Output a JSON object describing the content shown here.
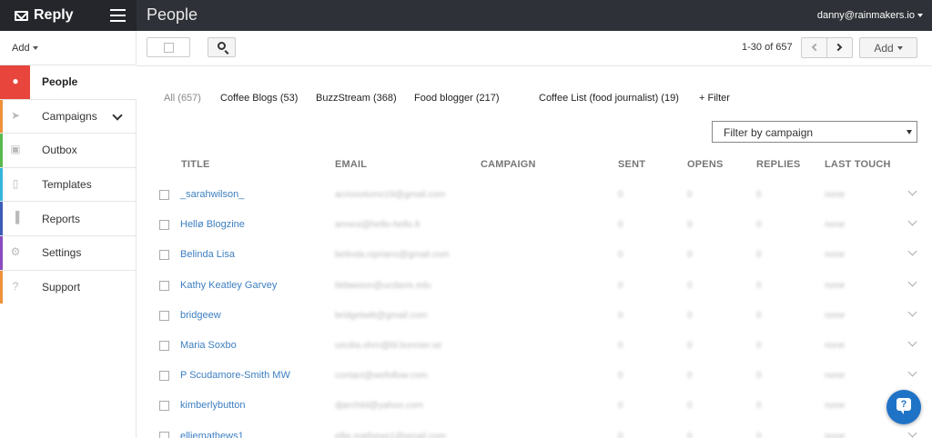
{
  "app": {
    "brand_name": "Reply",
    "page_title": "People",
    "user_email": "danny@rainmakers.io"
  },
  "sidebar": {
    "add_label": "Add",
    "items": [
      {
        "label": "People",
        "icon": "person-icon",
        "color": "#e8453c",
        "active": true
      },
      {
        "label": "Campaigns",
        "icon": "paper-plane-icon",
        "color": "#f0913a",
        "has_dropdown": true
      },
      {
        "label": "Outbox",
        "icon": "inbox-tray-icon",
        "color": "#59b94d"
      },
      {
        "label": "Templates",
        "icon": "document-icon",
        "color": "#35b5d8"
      },
      {
        "label": "Reports",
        "icon": "bar-chart-icon",
        "color": "#3d5bb8"
      },
      {
        "label": "Settings",
        "icon": "gear-icon",
        "color": "#8a4bc1"
      },
      {
        "label": "Support",
        "icon": "question-icon",
        "color": "#f0913a"
      }
    ]
  },
  "toolbar": {
    "pager_text": "1-30 of 657",
    "add_label": "Add"
  },
  "lists": {
    "tabs": [
      {
        "label": "All (657)",
        "active": true
      },
      {
        "label": "Coffee Blogs (53)"
      },
      {
        "label": "BuzzStream (368)"
      },
      {
        "label": "Food blogger (217)"
      },
      {
        "label": "Coffee List (food journalist) (19)"
      },
      {
        "label": "+ Filter"
      }
    ]
  },
  "filter": {
    "campaign_select": "Filter by campaign"
  },
  "table": {
    "columns": [
      "TITLE",
      "EMAIL",
      "CAMPAIGN",
      "SENT",
      "OPENS",
      "REPLIES",
      "LAST TOUCH"
    ],
    "rows": [
      {
        "title": "_sarahwilson_",
        "email": "acriosotomo19@gmail.com",
        "sent": "0",
        "opens": "0",
        "replies": "0",
        "last_touch": "none"
      },
      {
        "title": "Hellø Blogzine",
        "email": "annesi@hello-hello.fr",
        "sent": "0",
        "opens": "0",
        "replies": "0",
        "last_touch": "none"
      },
      {
        "title": "Belinda Lisa",
        "email": "belinda.cipriano@gmail.com",
        "sent": "0",
        "opens": "0",
        "replies": "0",
        "last_touch": "none"
      },
      {
        "title": "Kathy Keatley Garvey",
        "email": "bldawson@ucdavis.edu",
        "sent": "0",
        "opens": "0",
        "replies": "0",
        "last_touch": "none"
      },
      {
        "title": "bridgeew",
        "email": "bridgetwitt@gmail.com",
        "sent": "0",
        "opens": "0",
        "replies": "0",
        "last_touch": "none"
      },
      {
        "title": "Maria Soxbo",
        "email": "cecilia.ohrn@bl.bonnier.se",
        "sent": "0",
        "opens": "0",
        "replies": "0",
        "last_touch": "none"
      },
      {
        "title": "P Scudamore-Smith MW",
        "email": "contact@wefollow.com",
        "sent": "0",
        "opens": "0",
        "replies": "0",
        "last_touch": "none"
      },
      {
        "title": "kimberlybutton",
        "email": "djarchitd@yahoo.com",
        "sent": "0",
        "opens": "0",
        "replies": "0",
        "last_touch": "none"
      },
      {
        "title": "elliemathews1",
        "email": "ellie.mathews1@gmail.com",
        "sent": "0",
        "opens": "0",
        "replies": "0",
        "last_touch": "none"
      }
    ]
  }
}
